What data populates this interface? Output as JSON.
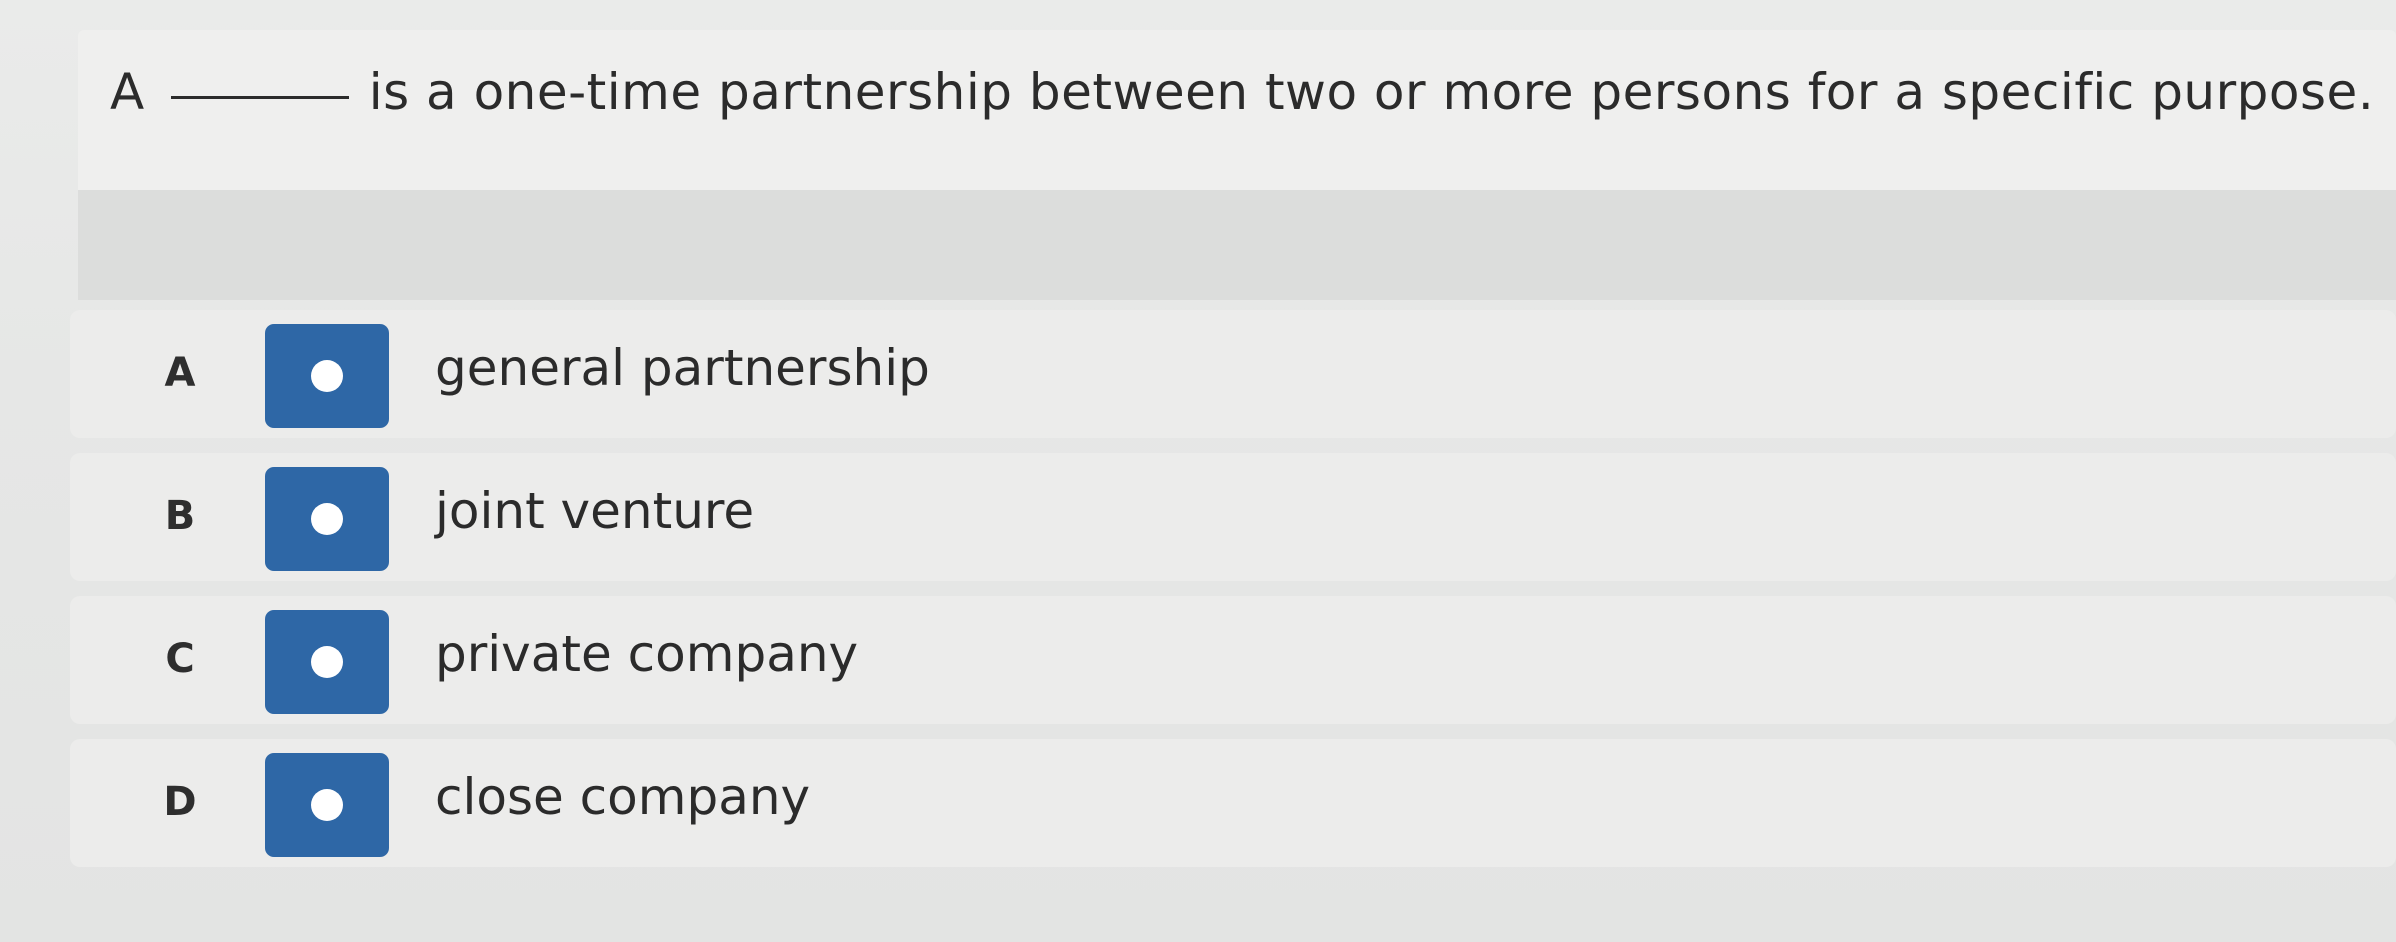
{
  "question": {
    "prefix": "A",
    "suffix": "is a one-time partnership between two or more persons for a specific purpose."
  },
  "options": [
    {
      "letter": "A",
      "label": "general partnership"
    },
    {
      "letter": "B",
      "label": "joint venture"
    },
    {
      "letter": "C",
      "label": "private company"
    },
    {
      "letter": "D",
      "label": "close company"
    }
  ],
  "colors": {
    "radio_fill": "#2e67a6",
    "radio_dot": "#ffffff",
    "text": "#2b2b2b",
    "background": "#e8e9e8"
  }
}
